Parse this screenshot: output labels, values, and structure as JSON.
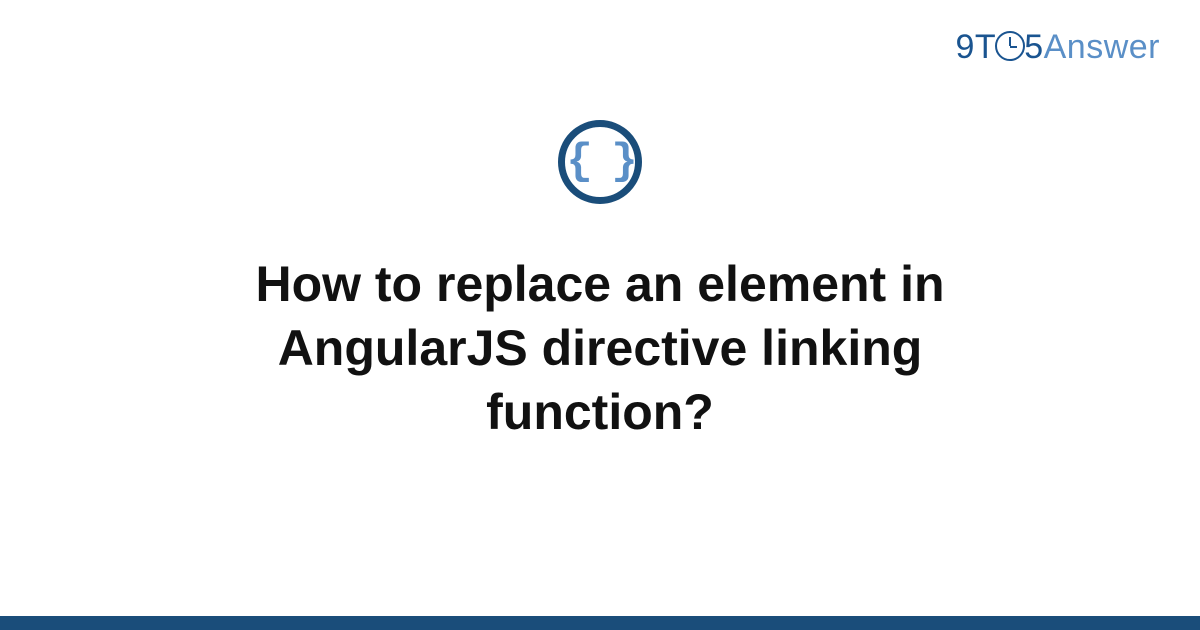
{
  "logo": {
    "part1": "9T",
    "part2": "5",
    "part3": "Answer"
  },
  "category_icon": {
    "symbol": "{ }",
    "name": "code-braces"
  },
  "question": {
    "title": "How to replace an element in AngularJS directive linking function?"
  },
  "colors": {
    "brand_dark": "#1a4d7a",
    "brand_light": "#5a8fc7",
    "text": "#111111"
  }
}
